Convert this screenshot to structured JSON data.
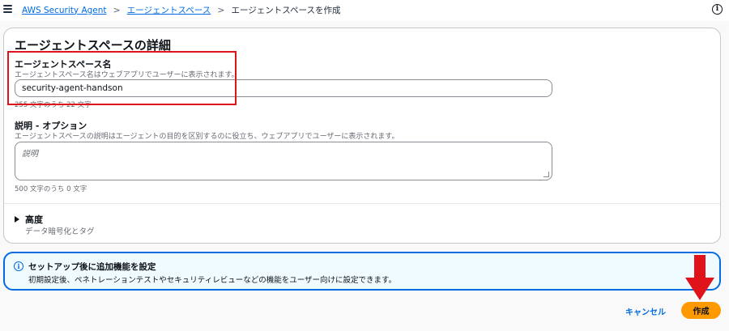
{
  "header": {
    "breadcrumbs": [
      "AWS Security Agent",
      "エージェントスペース",
      "エージェントスペースを作成"
    ],
    "separator": ">",
    "info_icon": "i"
  },
  "details": {
    "title": "エージェントスペースの詳細",
    "name_field": {
      "label": "エージェントスペース名",
      "description": "エージェントスペース名はウェブアプリでユーザーに表示されます。",
      "value": "security-agent-handson",
      "counter": "255 文字のうち 22 文字"
    },
    "description_field": {
      "label": "説明 - オプション",
      "description": "エージェントスペースの説明はエージェントの目的を区別するのに役立ち、ウェブアプリでユーザーに表示されます。",
      "placeholder": "説明",
      "counter": "500 文字のうち 0 文字"
    },
    "advanced": {
      "label": "高度",
      "description": "データ暗号化とタグ"
    }
  },
  "alert": {
    "icon": "i",
    "title": "セットアップ後に追加機能を設定",
    "body": "初期設定後、ペネトレーションテストやセキュリティレビューなどの機能をユーザー向けに設定できます。"
  },
  "actions": {
    "cancel_label": "キャンセル",
    "create_label": "作成"
  },
  "colors": {
    "accent": "#006ce0",
    "primary_button": "#ff9900",
    "annotation": "#e0121a"
  }
}
